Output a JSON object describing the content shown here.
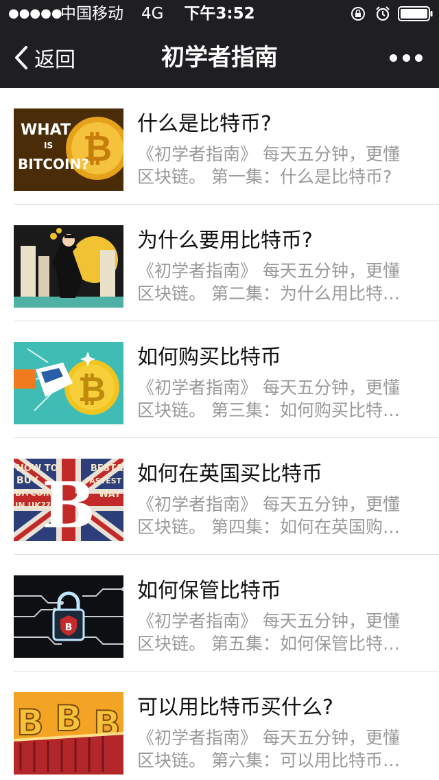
{
  "status_bar": {
    "signal_dots": "●●●●●",
    "carrier": "中国移动",
    "network": "4G",
    "time": "下午3:52"
  },
  "nav": {
    "back_label": "返回",
    "title": "初学者指南"
  },
  "articles": [
    {
      "title": "什么是比特币?",
      "desc_line1": "《初学者指南》 每天五分钟，更懂",
      "desc_line2": "区块链。 第一集：什么是比特币?"
    },
    {
      "title": "为什么要用比特币?",
      "desc_line1": "《初学者指南》 每天五分钟，更懂",
      "desc_line2": "区块链。 第二集：为什么用比特…"
    },
    {
      "title": "如何购买比特币",
      "desc_line1": "《初学者指南》 每天五分钟，更懂",
      "desc_line2": "区块链。 第三集：如何购买比特…"
    },
    {
      "title": "如何在英国买比特币",
      "desc_line1": "《初学者指南》 每天五分钟，更懂",
      "desc_line2": "区块链。 第四集：如何在英国购…"
    },
    {
      "title": "如何保管比特币",
      "desc_line1": "《初学者指南》 每天五分钟，更懂",
      "desc_line2": "区块链。 第五集：如何保管比特…"
    },
    {
      "title": "可以用比特币买什么?",
      "desc_line1": "《初学者指南》 每天五分钟，更懂",
      "desc_line2": "区块链。 第六集：可以用比特币…"
    }
  ],
  "thumb_text": {
    "t1_what": "WHAT",
    "t1_is": "IS",
    "t1_bitcoin": "BITCOIN?",
    "t4_howto": "HOW TO",
    "t4_buy": "BUY",
    "t4_bitcoin": "BITCOIN",
    "t4_inuk": "IN UK??",
    "t4_best": "BEST&",
    "t4_fastest": "FASTEST",
    "t4_way": "WAY"
  },
  "icons": {
    "back": "chevron-left-icon",
    "more": "more-dots-icon",
    "lock": "rotation-lock-icon",
    "alarm": "alarm-clock-icon",
    "battery": "battery-icon"
  },
  "colors": {
    "bar_bg": "#1f1f23",
    "title_text": "#111111",
    "desc_text": "#9a9a9a",
    "bitcoin_gold": "#f2b21b"
  }
}
